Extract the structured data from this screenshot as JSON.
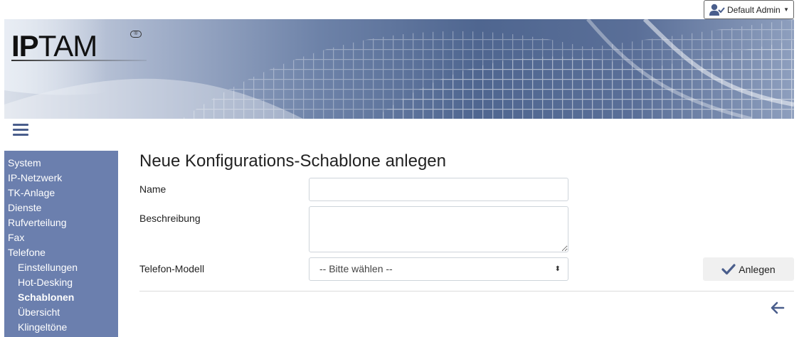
{
  "header": {
    "user_label": "Default Admin",
    "user_icon": "user-check-icon",
    "caret_icon": "caret-down-icon"
  },
  "banner": {
    "logo_bold": "IP",
    "logo_text": "TAM",
    "logo_mark": "®"
  },
  "menu": {
    "toggle_icon": "hamburger-icon"
  },
  "sidebar": {
    "items": [
      {
        "label": "System"
      },
      {
        "label": "IP-Netzwerk"
      },
      {
        "label": "TK-Anlage"
      },
      {
        "label": "Dienste"
      },
      {
        "label": "Rufverteilung"
      },
      {
        "label": "Fax"
      },
      {
        "label": "Telefone"
      },
      {
        "label": "Einstellungen"
      },
      {
        "label": "Hot-Desking"
      },
      {
        "label": "Schablonen"
      },
      {
        "label": "Übersicht"
      },
      {
        "label": "Klingeltöne"
      }
    ]
  },
  "main": {
    "title": "Neue Konfigurations-Schablone anlegen",
    "name_label": "Name",
    "name_value": "",
    "description_label": "Beschreibung",
    "description_value": "",
    "model_label": "Telefon-Modell",
    "model_selected": "-- Bitte wählen --",
    "submit_label": "Anlegen",
    "submit_icon": "check-icon",
    "back_icon": "arrow-left-icon"
  },
  "colors": {
    "sidebar_bg": "#6b7fae",
    "accent": "#4a5e8c",
    "button_bg": "#f0f0f0"
  }
}
